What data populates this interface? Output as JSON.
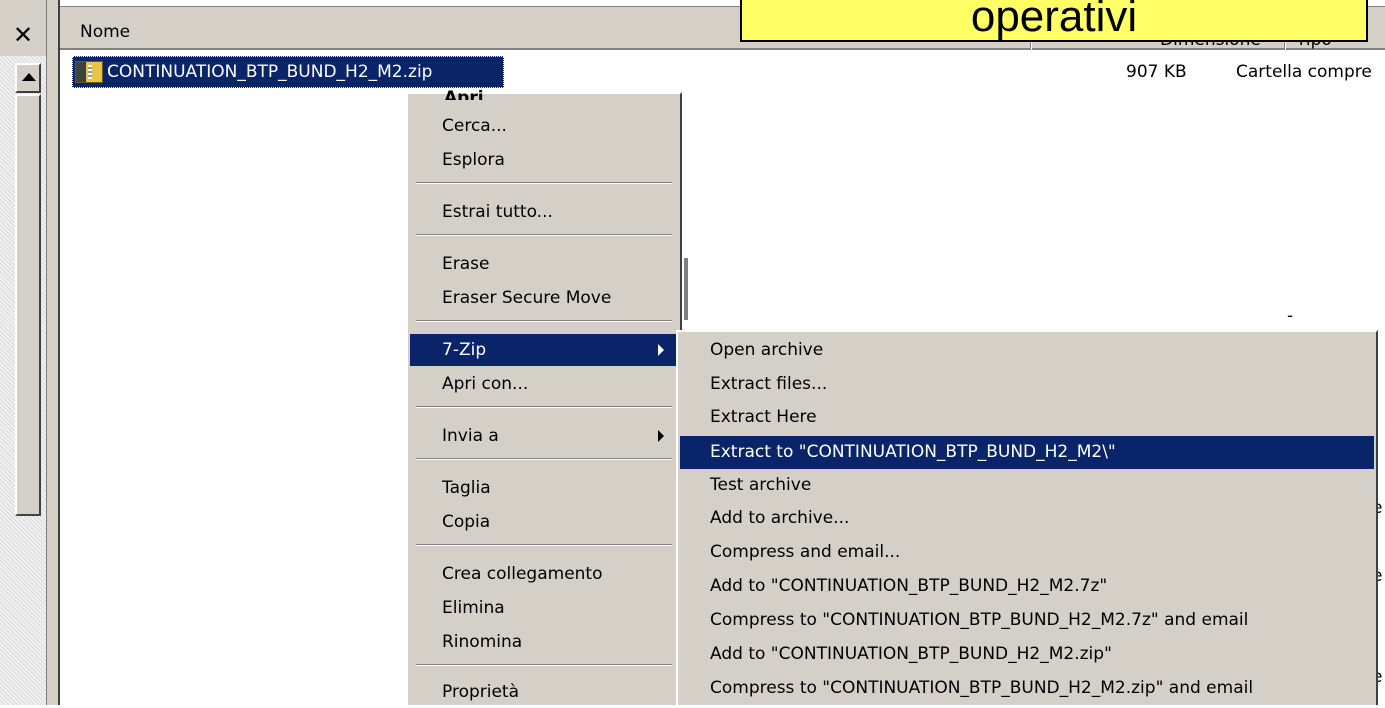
{
  "banner": {
    "text": "operativi"
  },
  "header": {
    "close_symbol": "✕",
    "col_name": "Nome",
    "col_size": "Dimensione",
    "col_type": "Tipo"
  },
  "file": {
    "name": "CONTINUATION_BTP_BUND_H2_M2.zip",
    "size": "907 KB",
    "type": "Cartella compre",
    "icon": "zip-folder-icon"
  },
  "edge": {
    "dash": "-",
    "e_char": "e"
  },
  "context_menu": {
    "top_cut": "Apri",
    "items": [
      {
        "label": "Cerca..."
      },
      {
        "label": "Esplora"
      },
      {
        "label": "Estrai tutto..."
      },
      {
        "label": "Erase"
      },
      {
        "label": "Eraser Secure Move"
      },
      {
        "label": "7-Zip"
      },
      {
        "label": "Apri con..."
      },
      {
        "label": "Invia a"
      },
      {
        "label": "Taglia"
      },
      {
        "label": "Copia"
      },
      {
        "label": "Crea collegamento"
      },
      {
        "label": "Elimina"
      },
      {
        "label": "Rinomina"
      },
      {
        "label": "Proprietà"
      }
    ]
  },
  "submenu": {
    "items": [
      {
        "label": "Open archive"
      },
      {
        "label": "Extract files..."
      },
      {
        "label": "Extract Here"
      },
      {
        "label": "Extract to \"CONTINUATION_BTP_BUND_H2_M2\\\""
      },
      {
        "label": "Test archive"
      },
      {
        "label": "Add to archive..."
      },
      {
        "label": "Compress and email..."
      },
      {
        "label": "Add to \"CONTINUATION_BTP_BUND_H2_M2.7z\""
      },
      {
        "label": "Compress to \"CONTINUATION_BTP_BUND_H2_M2.7z\" and email"
      },
      {
        "label": "Add to \"CONTINUATION_BTP_BUND_H2_M2.zip\""
      },
      {
        "label": "Compress to \"CONTINUATION_BTP_BUND_H2_M2.zip\" and email"
      }
    ]
  },
  "colors": {
    "selection": "#0a246a",
    "menu_bg": "#d4d0c8",
    "banner_bg": "#ffff66"
  }
}
